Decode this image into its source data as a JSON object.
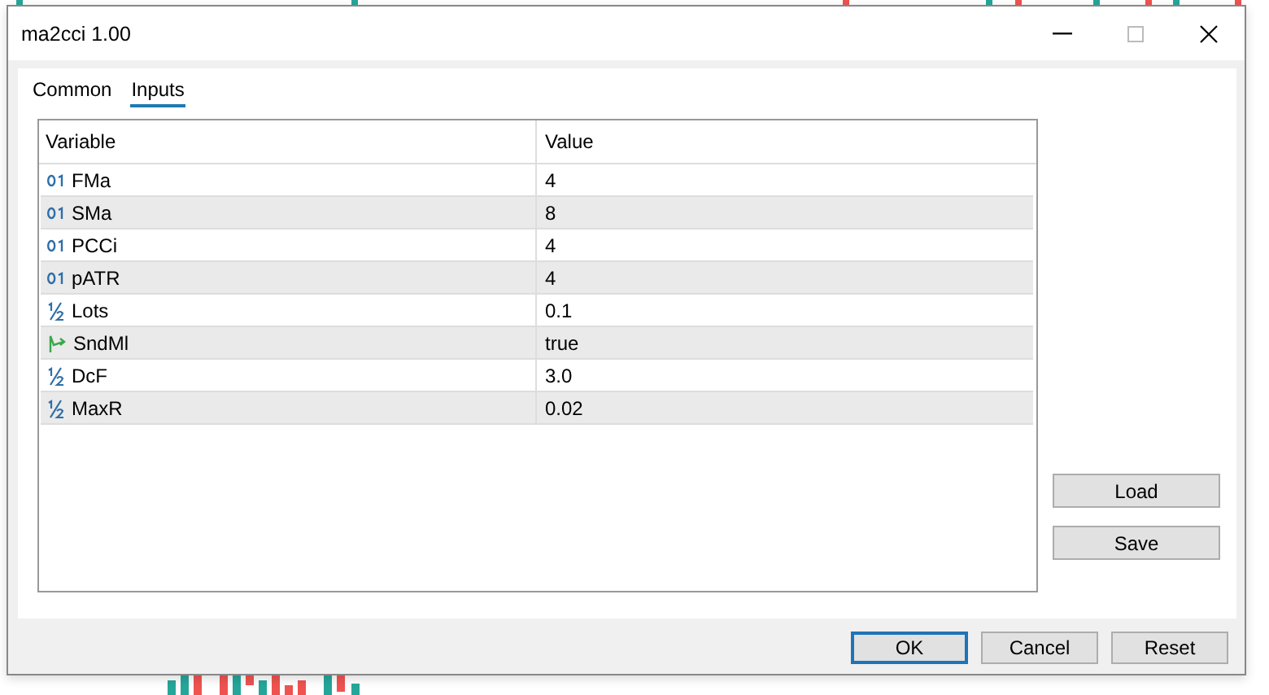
{
  "window": {
    "title": "ma2cci 1.00"
  },
  "tabs": [
    {
      "label": "Common",
      "selected": false
    },
    {
      "label": "Inputs",
      "selected": true
    }
  ],
  "table": {
    "columns": [
      "Variable",
      "Value"
    ],
    "rows": [
      {
        "kind": "int",
        "variable": "FMa",
        "value": "4"
      },
      {
        "kind": "int",
        "variable": "SMa",
        "value": "8"
      },
      {
        "kind": "int",
        "variable": "PCCi",
        "value": "4"
      },
      {
        "kind": "int",
        "variable": "pATR",
        "value": "4"
      },
      {
        "kind": "double",
        "variable": "Lots",
        "value": "0.1"
      },
      {
        "kind": "bool",
        "variable": "SndMl",
        "value": "true"
      },
      {
        "kind": "double",
        "variable": "DcF",
        "value": "3.0"
      },
      {
        "kind": "double",
        "variable": "MaxR",
        "value": "0.02"
      }
    ]
  },
  "side_buttons": [
    "Load",
    "Save"
  ],
  "buttons": [
    {
      "label": "OK",
      "default": true
    },
    {
      "label": "Cancel",
      "default": false
    },
    {
      "label": "Reset",
      "default": false
    }
  ]
}
